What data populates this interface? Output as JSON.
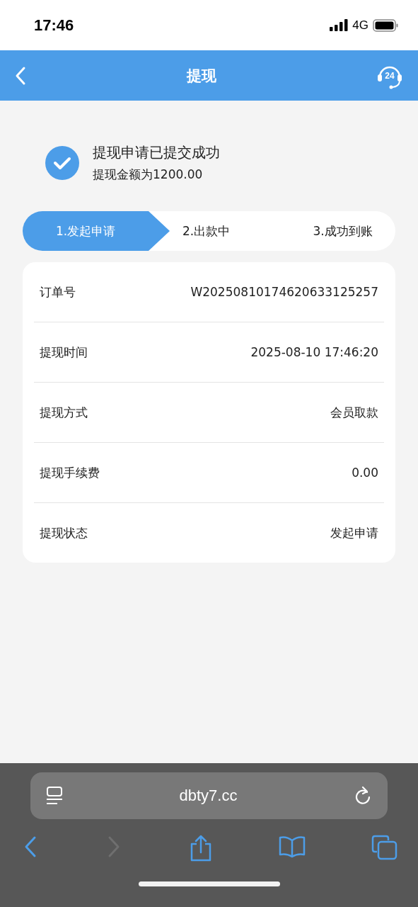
{
  "status_bar": {
    "time": "17:46",
    "network": "4G"
  },
  "nav": {
    "title": "提现",
    "support_badge": "24"
  },
  "result": {
    "title": "提现申请已提交成功",
    "subtitle": "提现金额为1200.00"
  },
  "steps": [
    {
      "label": "1.发起申请",
      "selected": true
    },
    {
      "label": "2.出款中",
      "selected": false
    },
    {
      "label": "3.成功到账",
      "selected": false
    }
  ],
  "details": [
    {
      "label": "订单号",
      "value": "W20250810174620633125257"
    },
    {
      "label": "提现时间",
      "value": "2025-08-10 17:46:20"
    },
    {
      "label": "提现方式",
      "value": "会员取款"
    },
    {
      "label": "提现手续费",
      "value": "0.00"
    },
    {
      "label": "提现状态",
      "value": "发起申请"
    }
  ],
  "browser": {
    "url": "dbty7.cc",
    "forward_disabled": true
  }
}
